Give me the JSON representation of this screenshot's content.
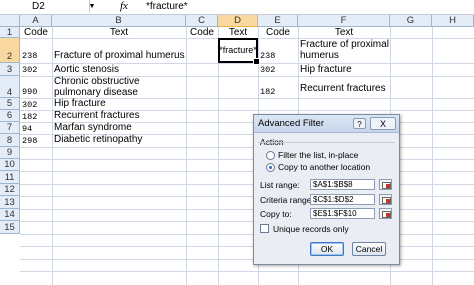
{
  "formula_bar": {
    "name_box": "D2",
    "fx_label": "fx",
    "value": "*fracture*"
  },
  "columns": [
    "A",
    "B",
    "C",
    "D",
    "E",
    "F",
    "G",
    "H"
  ],
  "selected_column": "D",
  "rows": [
    "1",
    "2",
    "3",
    "4",
    "5",
    "6",
    "7",
    "8",
    "9",
    "10",
    "11",
    "12",
    "13",
    "14",
    "15"
  ],
  "selected_row": "2",
  "cells": {
    "A1": "Code",
    "B1": "Text",
    "C1": "Code",
    "D1": "Text",
    "E1": "Code",
    "F1": "Text",
    "A2": "238",
    "B2": "Fracture of proximal humerus",
    "D2": "*fracture*",
    "E2": "238",
    "F2": "Fracture of proximal humerus",
    "A3": "302",
    "B3": "Aortic stenosis",
    "E3": "302",
    "F3": "Hip fracture",
    "A4": "990",
    "B4": "Chronic obstructive pulmonary disease",
    "E4": "182",
    "F4": "Recurrent fractures",
    "A5": "302",
    "B5": "Hip fracture",
    "A6": "182",
    "B6": "Recurrent fractures",
    "A7": "94",
    "B7": "Marfan syndrome",
    "A8": "298",
    "B8": "Diabetic retinopathy"
  },
  "dialog": {
    "title": "Advanced Filter",
    "help": "?",
    "close": "X",
    "action_label": "Action",
    "radio_filter": "Filter the list, in-place",
    "radio_copy": "Copy to another location",
    "list_range_label": "List range:",
    "list_range_value": "$A$1:$B$8",
    "criteria_range_label": "Criteria range:",
    "criteria_range_value": "$C$1:$D$2",
    "copy_to_label": "Copy to:",
    "copy_to_value": "$E$1:$F$10",
    "unique_label": "Unique records only",
    "ok": "OK",
    "cancel": "Cancel"
  }
}
